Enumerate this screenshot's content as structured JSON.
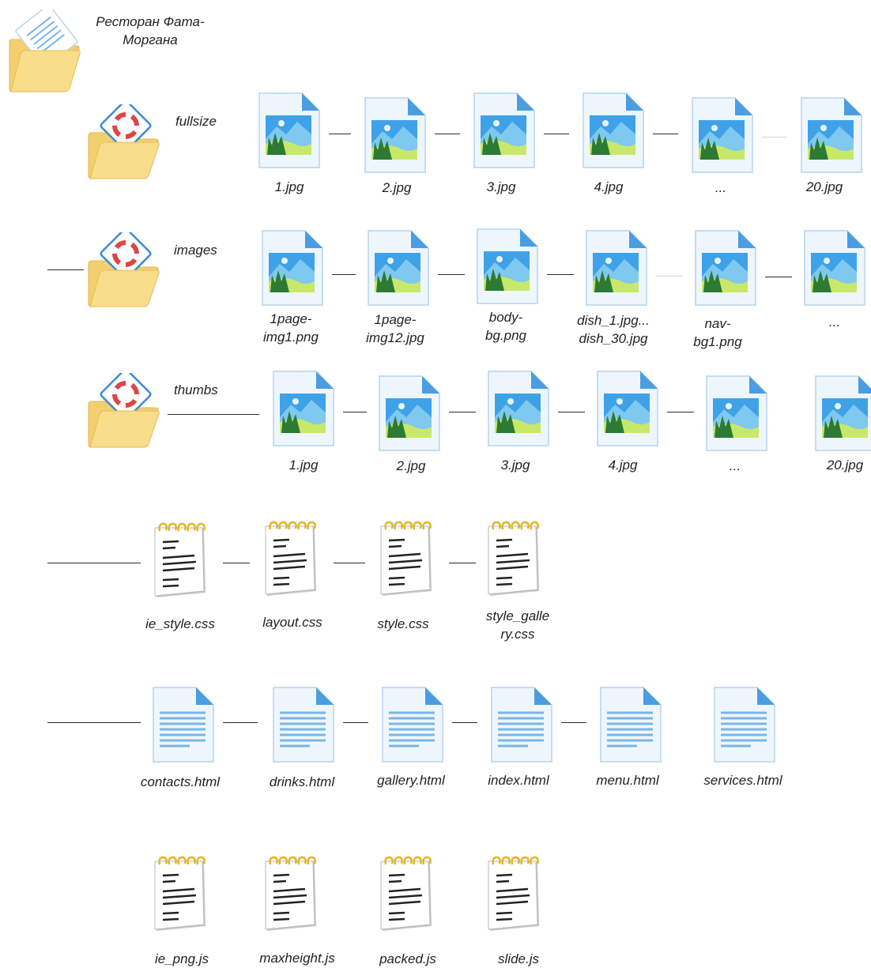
{
  "root": {
    "name": "Ресторан Фата-Моргана"
  },
  "folders": [
    {
      "name": "fullsize"
    },
    {
      "name": "images"
    },
    {
      "name": "thumbs"
    }
  ],
  "rows": {
    "fullsize": [
      "1.jpg",
      "2.jpg",
      "3.jpg",
      "4.jpg",
      "...",
      "20.jpg"
    ],
    "images": [
      "1page-img1.png",
      "1page-img12.jpg",
      "body-bg.png",
      "dish_1.jpg... dish_30.jpg",
      "nav-bg1.png",
      "..."
    ],
    "thumbs": [
      "1.jpg",
      "2.jpg",
      "3.jpg",
      "4.jpg",
      "...",
      "20.jpg"
    ],
    "css": [
      "ie_style.css",
      "layout.css",
      "style.css",
      "style_gallery.css"
    ],
    "html": [
      "contacts.html",
      "drinks.html",
      "gallery.html",
      "index.html",
      "menu.html",
      "services.html"
    ],
    "js": [
      "ie_png.js",
      "maxheight.js",
      "packed.js",
      "slide.js"
    ]
  },
  "icons": {
    "root_folder": "folder-document-icon",
    "sub_folder": "folder-browser-icon",
    "image_file": "image-file-icon",
    "text_file": "notepad-file-icon",
    "html_file": "document-file-icon"
  },
  "colors": {
    "folder_fill": "#f5d67e",
    "file_page": "#eef6fd",
    "file_fold": "#4a9de0",
    "sky": "#3fa2e8",
    "hills": "#2c7a34",
    "text_line": "#7ab6e6",
    "spiral": "#e0b62a"
  }
}
